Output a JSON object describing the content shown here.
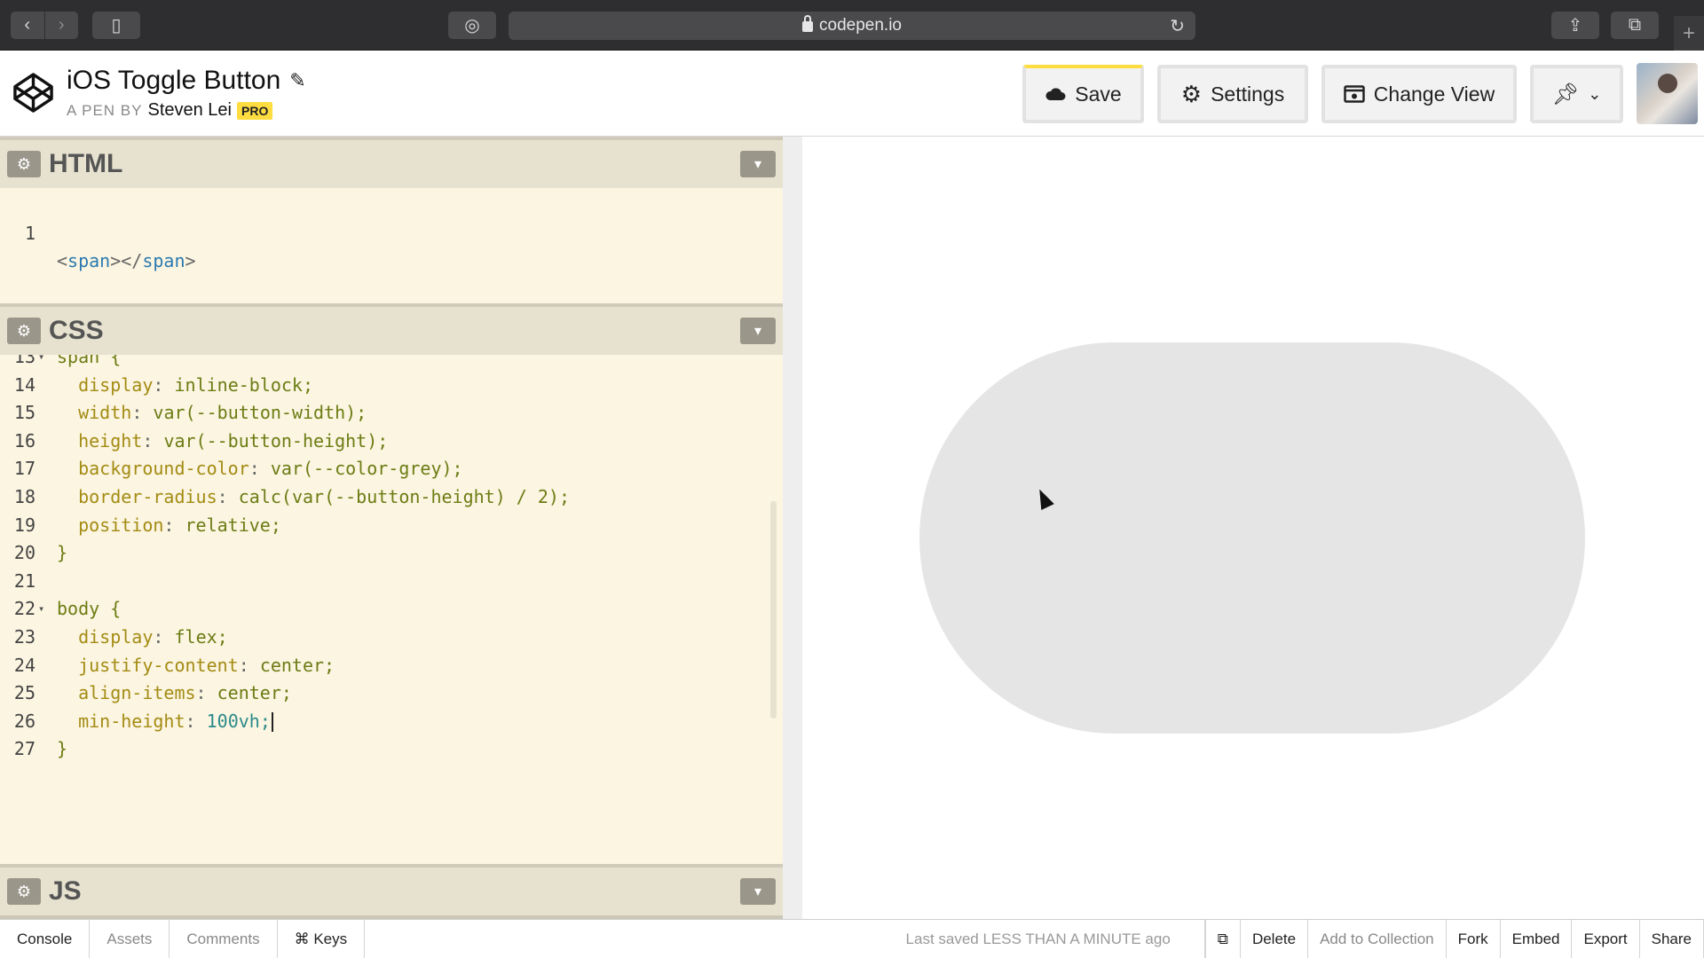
{
  "browser": {
    "url": "codepen.io"
  },
  "pen": {
    "title": "iOS Toggle Button",
    "by_label": "A PEN BY",
    "author": "Steven Lei",
    "badge": "PRO"
  },
  "header_buttons": {
    "save": "Save",
    "settings": "Settings",
    "change_view": "Change View"
  },
  "panes": {
    "html": {
      "label": "HTML",
      "lines": [
        {
          "n": "1",
          "open": "<",
          "tag": "span",
          "mid": "></",
          "tag2": "span",
          "close": ">"
        }
      ]
    },
    "css": {
      "label": "CSS",
      "lines": [
        {
          "n": "13",
          "fold": "▾",
          "text": "span {"
        },
        {
          "n": "14",
          "prop": "display",
          "val": "inline-block;"
        },
        {
          "n": "15",
          "prop": "width",
          "val": "var(--button-width);"
        },
        {
          "n": "16",
          "prop": "height",
          "val": "var(--button-height);"
        },
        {
          "n": "17",
          "prop": "background-color",
          "val": "var(--color-grey);"
        },
        {
          "n": "18",
          "prop": "border-radius",
          "val": "calc(var(--button-height) / 2);"
        },
        {
          "n": "19",
          "prop": "position",
          "val": "relative;"
        },
        {
          "n": "20",
          "text": "}"
        },
        {
          "n": "21",
          "text": ""
        },
        {
          "n": "22",
          "fold": "▾",
          "text": "body {"
        },
        {
          "n": "23",
          "prop": "display",
          "val": "flex;"
        },
        {
          "n": "24",
          "prop": "justify-content",
          "val": "center;"
        },
        {
          "n": "25",
          "prop": "align-items",
          "val": "center;"
        },
        {
          "n": "26",
          "prop": "min-height",
          "val": "100vh;"
        },
        {
          "n": "27",
          "text": "}"
        }
      ]
    },
    "js": {
      "label": "JS"
    }
  },
  "footer": {
    "console": "Console",
    "assets": "Assets",
    "comments": "Comments",
    "keys": "⌘ Keys",
    "status": "Last saved LESS THAN A MINUTE ago",
    "delete": "Delete",
    "add_to_collection": "Add to Collection",
    "fork": "Fork",
    "embed": "Embed",
    "export": "Export",
    "share": "Share"
  },
  "icons": {
    "back": "chevron-left-icon",
    "forward": "chevron-right-icon",
    "sidebar": "sidebar-icon",
    "password": "password-icon",
    "lock": "lock-icon",
    "reload": "reload-icon",
    "share": "share-icon",
    "tabs": "tabs-icon",
    "cloud": "cloud-icon",
    "gear": "gear-icon",
    "view": "eye-icon",
    "pin": "pin-icon"
  }
}
